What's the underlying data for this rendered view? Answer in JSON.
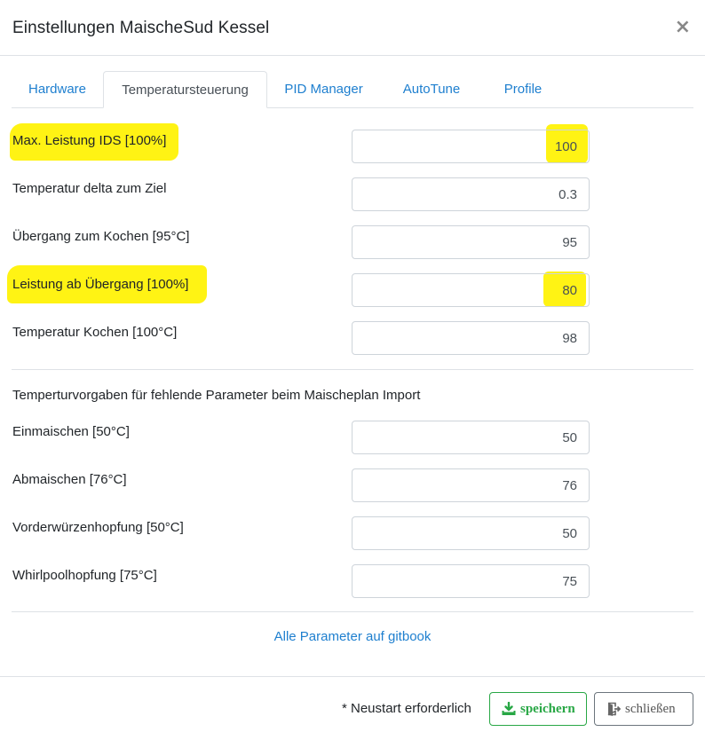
{
  "modal": {
    "title": "Einstellungen MaischeSud Kessel",
    "close_glyph": "×"
  },
  "tabs": [
    {
      "label": "Hardware",
      "active": false
    },
    {
      "label": "Temperatursteuerung",
      "active": true
    },
    {
      "label": "PID Manager",
      "active": false
    },
    {
      "label": "AutoTune",
      "active": false
    },
    {
      "label": "Profile",
      "active": false
    }
  ],
  "settings": [
    {
      "label": "Max. Leistung IDS [100%]",
      "value": "100",
      "highlighted": true
    },
    {
      "label": "Temperatur delta zum Ziel",
      "value": "0.3",
      "highlighted": false
    },
    {
      "label": "Übergang zum Kochen [95°C]",
      "value": "95",
      "highlighted": false
    },
    {
      "label": "Leistung ab Übergang [100%]",
      "value": "80",
      "highlighted": true
    },
    {
      "label": "Temperatur Kochen [100°C]",
      "value": "98",
      "highlighted": false
    }
  ],
  "import_section": {
    "heading": "Temperturvorgaben für fehlende Parameter beim Maischeplan Import",
    "fields": [
      {
        "label": "Einmaischen [50°C]",
        "value": "50"
      },
      {
        "label": "Abmaischen [76°C]",
        "value": "76"
      },
      {
        "label": "Vorderwürzenhopfung [50°C]",
        "value": "50"
      },
      {
        "label": "Whirlpoolhopfung [75°C]",
        "value": "75"
      }
    ]
  },
  "link": {
    "label": "Alle Parameter auf gitbook"
  },
  "footer": {
    "restart_note": "* Neustart erforderlich",
    "save_label": "speichern",
    "close_label": "schließen"
  },
  "colors": {
    "link": "#1e7fcf",
    "save": "#28a745",
    "highlight": "#fff200"
  }
}
